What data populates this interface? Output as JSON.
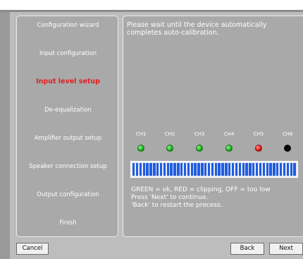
{
  "wizard": {
    "steps": [
      {
        "label": "Configuration wizard",
        "active": false
      },
      {
        "label": "Input configuration",
        "active": false
      },
      {
        "label": "Input level setup",
        "active": true
      },
      {
        "label": "De-equalization",
        "active": false
      },
      {
        "label": "Amplifier output setup",
        "active": false
      },
      {
        "label": "Speaker connection setup",
        "active": false
      },
      {
        "label": "Output configuration",
        "active": false
      },
      {
        "label": "Finish",
        "active": false
      }
    ]
  },
  "main": {
    "message": "Please wait until the device automatically completes auto-calibration.",
    "channels": [
      {
        "label": "CH1",
        "status": "green"
      },
      {
        "label": "CH2",
        "status": "green"
      },
      {
        "label": "CH3",
        "status": "green"
      },
      {
        "label": "CH4",
        "status": "green"
      },
      {
        "label": "CH5",
        "status": "red"
      },
      {
        "label": "CH6",
        "status": "off"
      }
    ],
    "progress": {
      "fraction": 1.0,
      "color": "#1f5ce0"
    },
    "legend": [
      "GREEN = ok, RED = clipping, OFF = too low",
      "Press 'Next' to continue.",
      "'Back' to restart the process."
    ]
  },
  "buttons": {
    "cancel": "Cancel",
    "back": "Back",
    "next": "Next"
  },
  "colors": {
    "active_step": "#e11f1f",
    "led_ok": "#28c02a",
    "led_clipping": "#ee2222",
    "led_off": "#050505"
  }
}
